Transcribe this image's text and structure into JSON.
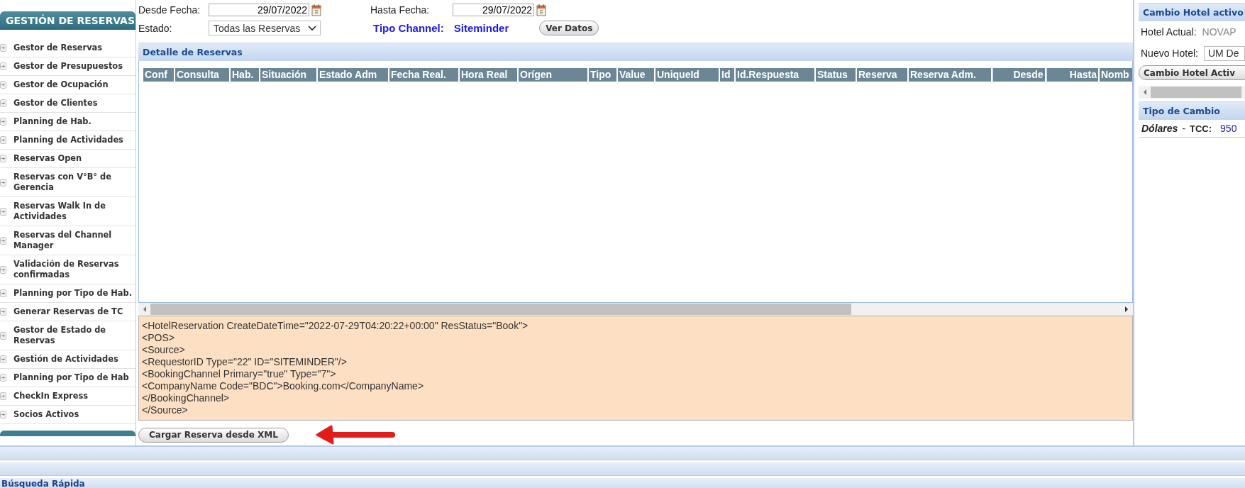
{
  "sidebar": {
    "title": "GESTIÓN DE RESERVAS",
    "items": [
      {
        "label": "Gestor de Reservas"
      },
      {
        "label": "Gestor de Presupuestos"
      },
      {
        "label": "Gestor de Ocupación"
      },
      {
        "label": "Gestor de Clientes"
      },
      {
        "label": "Planning de Hab."
      },
      {
        "label": "Planning de Actividades"
      },
      {
        "label": "Reservas Open"
      },
      {
        "label": "Reservas con V°B° de Gerencia"
      },
      {
        "label": "Reservas Walk In de Actividades"
      },
      {
        "label": "Reservas del Channel Manager"
      },
      {
        "label": "Validación de Reservas confirmadas"
      },
      {
        "label": "Planning por Tipo de Hab."
      },
      {
        "label": "Generar Reservas de TC"
      },
      {
        "label": "Gestor de Estado de Reservas"
      },
      {
        "label": "Gestión de Actividades"
      },
      {
        "label": "Planning por Tipo de Hab"
      },
      {
        "label": "CheckIn Express"
      },
      {
        "label": "Socios Activos"
      }
    ]
  },
  "filters": {
    "desde_label": "Desde Fecha:",
    "desde_value": "29/07/2022",
    "hasta_label": "Hasta Fecha:",
    "hasta_value": "29/07/2022",
    "estado_label": "Estado:",
    "estado_value": "Todas las Reservas",
    "channel_label": "Tipo Channel:",
    "channel_value": "Siteminder",
    "button": "Ver Datos"
  },
  "detail": {
    "title": "Detalle de Reservas",
    "columns": [
      {
        "label": "Conf"
      },
      {
        "label": "Consulta"
      },
      {
        "label": "Hab."
      },
      {
        "label": "Situación"
      },
      {
        "label": "Estado Adm"
      },
      {
        "label": "Fecha Real."
      },
      {
        "label": "Hora Real"
      },
      {
        "label": "Orígen"
      },
      {
        "label": "Tipo"
      },
      {
        "label": "Value"
      },
      {
        "label": "UniqueId"
      },
      {
        "label": "Id"
      },
      {
        "label": "Id.Respuesta"
      },
      {
        "label": "Status"
      },
      {
        "label": "Reserva"
      },
      {
        "label": "Reserva Adm."
      },
      {
        "label": "Desde"
      },
      {
        "label": "Hasta"
      },
      {
        "label": "Nomb"
      }
    ],
    "xml_lines": [
      "<HotelReservation CreateDateTime=\"2022-07-29T04:20:22+00:00\" ResStatus=\"Book\">",
      "<POS>",
      "<Source>",
      "<RequestorID Type=\"22\" ID=\"SITEMINDER\"/>",
      "<BookingChannel Primary=\"true\" Type=\"7\">",
      "<CompanyName Code=\"BDC\">Booking.com</CompanyName>",
      "</BookingChannel>",
      "</Source>"
    ],
    "load_button": "Cargar Reserva desde XML"
  },
  "hotel_panel": {
    "title": "Cambio Hotel activo",
    "current_label": "Hotel Actual:",
    "current_value": "NOVAP",
    "new_label": "Nuevo Hotel:",
    "new_value": "UM De",
    "button": "Cambio Hotel Activ"
  },
  "exchange": {
    "title": "Tipo de Cambio",
    "currency": "Dólares",
    "separator": "-",
    "tcc_label": "TCC:",
    "tcc_value": "950"
  },
  "quick_search": {
    "title": "Búsqueda Rápida"
  }
}
